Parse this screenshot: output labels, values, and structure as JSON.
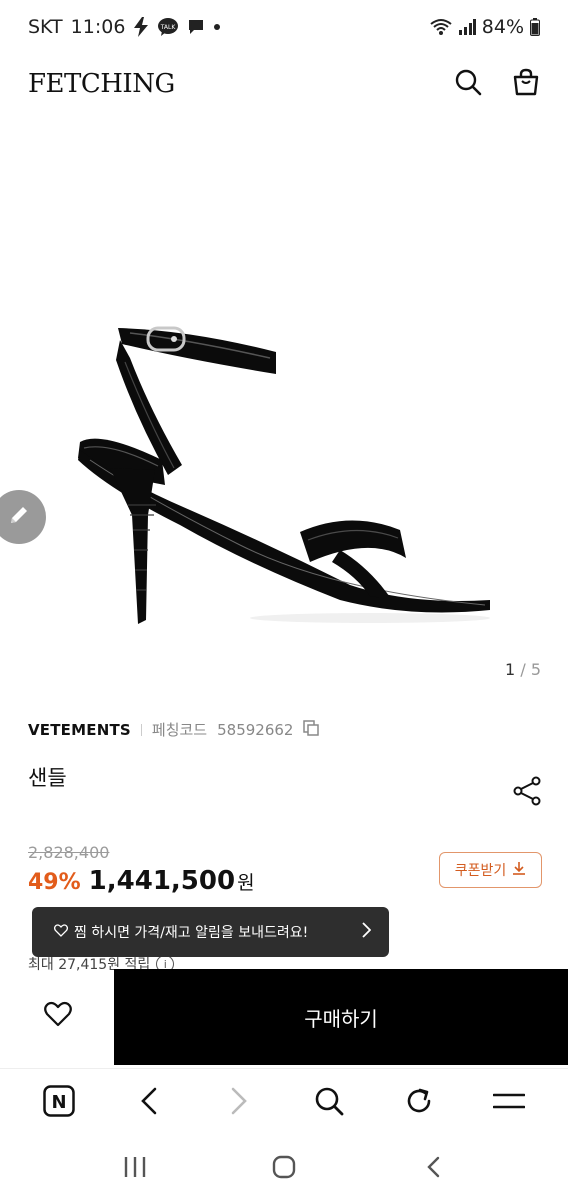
{
  "status": {
    "carrier": "SKT",
    "time": "11:06",
    "talk_badge": "TALK",
    "battery": "84%"
  },
  "header": {
    "logo": "FETCHING",
    "icons": [
      "search-icon",
      "shopping-bag-icon"
    ]
  },
  "gallery": {
    "current": "1",
    "separator": "/",
    "total": "5"
  },
  "product": {
    "brand": "VETEMENTS",
    "code_label": "페칭코드",
    "code_value": "58592662",
    "name": "샌들",
    "original_price": "2,828,400",
    "discount": "49%",
    "price": "1,441,500",
    "currency": "원",
    "coupon_label": "쿠폰받기",
    "points_text": "최대 27,415원 적립",
    "info_glyph": "i"
  },
  "toast": {
    "text": "찜 하시면 가격/재고 알림을 보내드려요!"
  },
  "purchase": {
    "buy_label": "구매하기"
  },
  "browser": {
    "home_glyph": "N"
  },
  "colors": {
    "accent_orange": "#e25c1b",
    "buy_bg": "#000000",
    "toast_bg": "#2e2e2e"
  }
}
